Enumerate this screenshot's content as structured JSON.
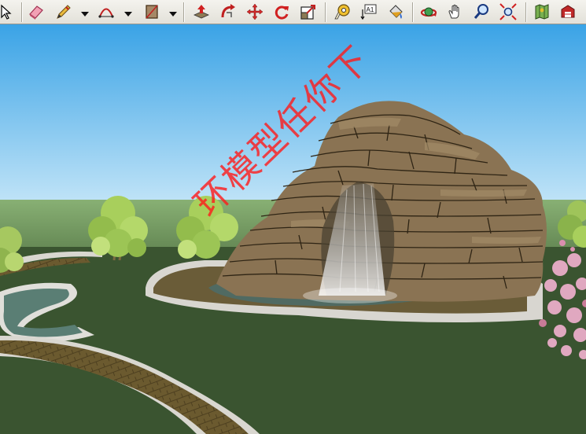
{
  "toolbar": {
    "tools": [
      {
        "name": "select-tool",
        "icon": "arrow-cursor-icon"
      },
      {
        "name": "eraser-tool",
        "icon": "eraser-icon"
      },
      {
        "name": "pencil-line-tool",
        "icon": "pencil-icon",
        "dropdown": true
      },
      {
        "name": "arc-tool",
        "icon": "arc-icon",
        "dropdown": true
      },
      {
        "name": "rectangle-tool",
        "icon": "rectangle-icon",
        "dropdown": true
      },
      {
        "name": "push-pull-tool",
        "icon": "push-pull-icon"
      },
      {
        "name": "follow-me-tool",
        "icon": "follow-me-icon"
      },
      {
        "name": "move-tool",
        "icon": "move-arrows-icon"
      },
      {
        "name": "rotate-tool",
        "icon": "rotate-icon"
      },
      {
        "name": "scale-tool",
        "icon": "scale-icon"
      },
      {
        "name": "tape-measure-tool",
        "icon": "tape-measure-icon"
      },
      {
        "name": "text-tool",
        "icon": "text-label-icon",
        "label": "A1"
      },
      {
        "name": "paint-bucket-tool",
        "icon": "paint-bucket-icon"
      },
      {
        "name": "orbit-tool",
        "icon": "orbit-icon"
      },
      {
        "name": "pan-tool",
        "icon": "hand-icon"
      },
      {
        "name": "zoom-tool",
        "icon": "magnifier-icon"
      },
      {
        "name": "zoom-extents-tool",
        "icon": "zoom-extents-icon"
      },
      {
        "name": "add-location-tool",
        "icon": "map-location-icon"
      },
      {
        "name": "warehouse-tool",
        "icon": "warehouse-icon"
      }
    ]
  },
  "scene": {
    "watermark_text": "环模型任你下",
    "colors": {
      "sky_top": "#3aa3e6",
      "sky_bottom": "#bfe3f7",
      "grass": "#3a5430",
      "path": "#6b5a2f",
      "rock": "#8a7353",
      "water": "#506a62",
      "pond_edge": "#e8e6e0",
      "watermark": "#ff1a1a"
    }
  }
}
